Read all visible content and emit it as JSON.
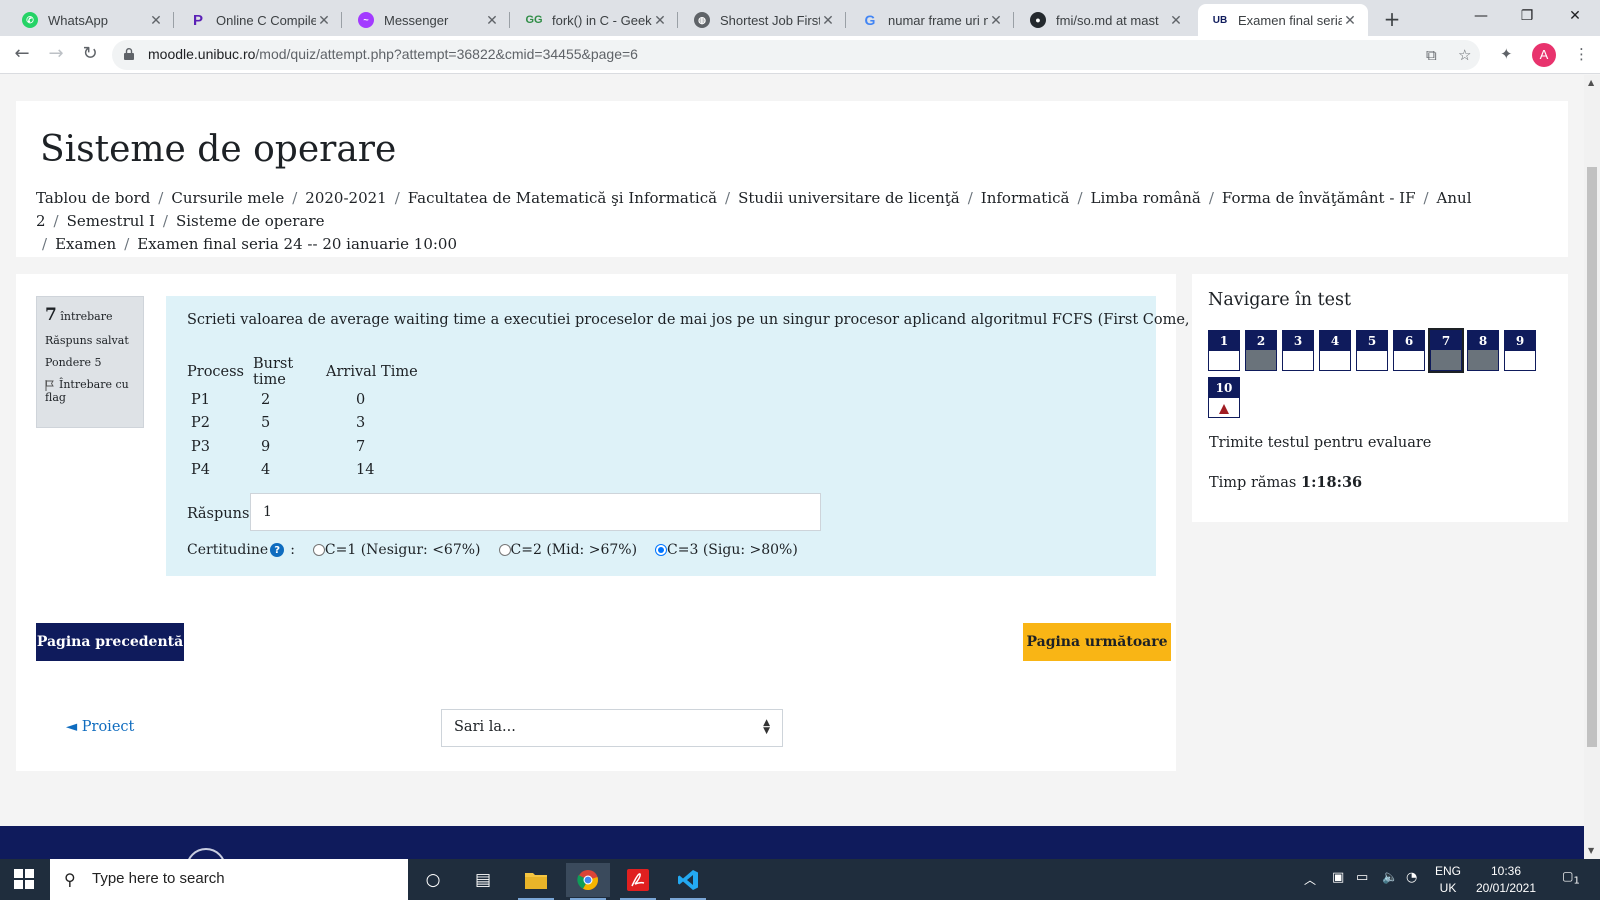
{
  "browser": {
    "tabs": [
      {
        "title": "WhatsApp",
        "icon": "whatsapp-icon",
        "color": "#25d366"
      },
      {
        "title": "Online C Compiler",
        "icon": "programiz-icon",
        "color": "#5b21b6"
      },
      {
        "title": "Messenger",
        "icon": "messenger-icon",
        "color": "#a33bff"
      },
      {
        "title": "fork() in C - Geeksf",
        "icon": "geeksforgeeks-icon",
        "color": "#2f8d46"
      },
      {
        "title": "Shortest Job First (",
        "icon": "globe-icon",
        "color": "#5f6368"
      },
      {
        "title": "numar frame uri n",
        "icon": "google-icon",
        "color": "#4285f4"
      },
      {
        "title": "fmi/so.md at mast",
        "icon": "github-icon",
        "color": "#24292e"
      },
      {
        "title": "Examen final seria",
        "icon": "unibuc-icon",
        "color": "#0f1b5c",
        "badge": "UB"
      }
    ],
    "url_host": "moodle.unibuc.ro",
    "url_path": "/mod/quiz/attempt.php?attempt=36822&cmid=34455&page=6",
    "profile_initial": "A"
  },
  "page": {
    "title": "Sisteme de operare",
    "breadcrumb": [
      "Tablou de bord",
      "Cursurile mele",
      "2020-2021",
      "Facultatea de Matematică şi Informatică",
      "Studii universitare de licenţă",
      "Informatică",
      "Limba română",
      "Forma de învăţământ - IF",
      "Anul 2",
      "Semestrul I",
      "Sisteme de operare",
      "Examen",
      "Examen final seria 24 -- 20 ianuarie 10:00"
    ]
  },
  "question_info": {
    "number": "7",
    "number_label": "întrebare",
    "status": "Răspuns salvat",
    "weight": "Pondere 5",
    "flag_label": "Întrebare cu flag"
  },
  "question": {
    "text": "Scrieti valoarea de average waiting time a executiei proceselor de mai jos pe un singur procesor aplicand algoritmul FCFS (First Come, First Served):",
    "table_headers": [
      "Process",
      "Burst time",
      "Arrival Time"
    ],
    "table_rows": [
      [
        "P1",
        "2",
        "0"
      ],
      [
        "P2",
        "5",
        "3"
      ],
      [
        "P3",
        "9",
        "7"
      ],
      [
        "P4",
        "4",
        "14"
      ]
    ],
    "answer_label": "Răspuns:",
    "answer_value": "1",
    "certainty_label": "Certitudine",
    "certainty_sep": ":",
    "certainty_options": [
      {
        "label": "C=1 (Nesigur: <67%)",
        "selected": false
      },
      {
        "label": "C=2 (Mid: >67%)",
        "selected": false
      },
      {
        "label": "C=3 (Sigu: >80%)",
        "selected": true
      }
    ]
  },
  "navigation": {
    "prev_button": "Pagina precedentă",
    "next_button": "Pagina următoare",
    "prev_activity": "◄ Proiect",
    "jump_placeholder": "Sari la..."
  },
  "quiz_nav": {
    "title": "Navigare în test",
    "questions": [
      {
        "n": "1",
        "state": "unanswered"
      },
      {
        "n": "2",
        "state": "answered"
      },
      {
        "n": "3",
        "state": "unanswered"
      },
      {
        "n": "4",
        "state": "unanswered"
      },
      {
        "n": "5",
        "state": "unanswered"
      },
      {
        "n": "6",
        "state": "unanswered"
      },
      {
        "n": "7",
        "state": "answered-current"
      },
      {
        "n": "8",
        "state": "answered"
      },
      {
        "n": "9",
        "state": "unanswered"
      },
      {
        "n": "10",
        "state": "flagged"
      }
    ],
    "submit_label": "Trimite testul pentru evaluare",
    "timer_label": "Timp rămas",
    "timer_value": "1:18:36"
  },
  "taskbar": {
    "search_placeholder": "Type here to search",
    "lang_top": "ENG",
    "lang_bottom": "UK",
    "time": "10:36",
    "date": "20/01/2021",
    "notifications": "1"
  }
}
